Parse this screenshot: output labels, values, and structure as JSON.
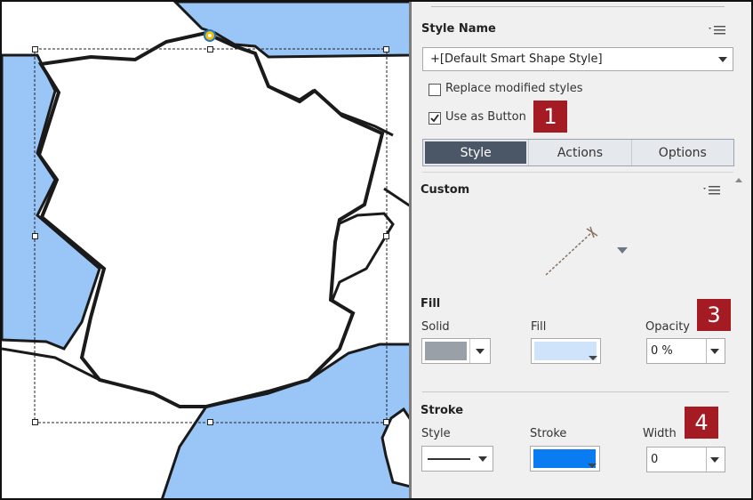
{
  "style_panel": {
    "style_name_label": "Style Name",
    "style_name_value": "+[Default Smart Shape Style]",
    "replace_modified_styles_label": "Replace modified styles",
    "replace_modified_styles_checked": false,
    "use_as_button_label": "Use as Button",
    "use_as_button_checked": true
  },
  "tabs": [
    {
      "label": "Style",
      "active": true
    },
    {
      "label": "Actions",
      "active": false
    },
    {
      "label": "Options",
      "active": false
    }
  ],
  "custom_label": "Custom",
  "fill": {
    "section_label": "Fill",
    "solid_label": "Solid",
    "fill_label": "Fill",
    "opacity_label": "Opacity",
    "opacity_value": "0 %",
    "solid_color": "#9aa0a8",
    "fill_color": "#cfe3fb"
  },
  "stroke": {
    "section_label": "Stroke",
    "style_label": "Style",
    "stroke_label": "Stroke",
    "width_label": "Width",
    "width_value": "0",
    "stroke_color": "#0a7cf2"
  },
  "badges": [
    "1",
    "3",
    "4"
  ],
  "colors": {
    "map_water": "#99c6f7",
    "map_land": "#ffffff",
    "map_border": "#1a1a1a",
    "badge_red": "#a51b24",
    "active_tab": "#4b5666"
  }
}
